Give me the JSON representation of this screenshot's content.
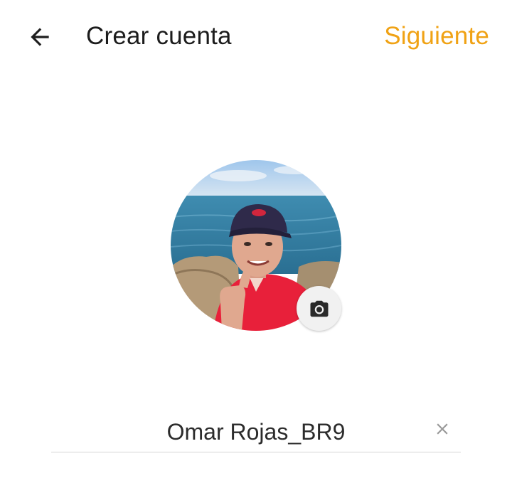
{
  "header": {
    "back_icon": "arrow-left-icon",
    "title": "Crear cuenta",
    "next_label": "Siguiente"
  },
  "profile": {
    "avatar_icon": "profile-photo",
    "camera_icon": "camera-icon"
  },
  "name_field": {
    "value": "Omar Rojas_BR9",
    "clear_icon": "close-icon"
  },
  "colors": {
    "accent": "#f0a214",
    "title": "#1c1c1c",
    "underline": "#d6d6d6"
  }
}
